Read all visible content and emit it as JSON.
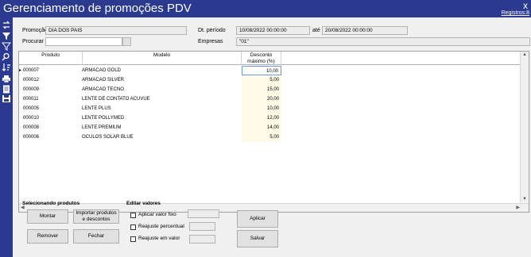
{
  "window": {
    "title": "Gerenciamento de promoções PDV",
    "close_glyph": "x",
    "registros_link": "Registros:8"
  },
  "toolbar": {
    "icons": [
      "transfer-icon",
      "filter-icon",
      "filter-outline-icon",
      "search-icon",
      "sort-icon",
      "print-icon",
      "document-icon",
      "save-icon"
    ]
  },
  "form": {
    "promocao_label": "Promoção",
    "promocao_value": "DIA DOS PAIS",
    "procurar_label": "Procurar",
    "procurar_value": "",
    "periodo_label": "Dt. período",
    "periodo_de": "10/08/2022 00:00:00",
    "ate_label": "até",
    "periodo_ate": "20/08/2022 00:00:00",
    "empresas_label": "Empresas",
    "empresas_value": "\"01\""
  },
  "grid": {
    "headers": {
      "produto": "Produto",
      "modelo": "Modelo",
      "desconto": "Desconto máximo (%)"
    },
    "rows": [
      {
        "produto": "000007",
        "modelo": "ARMACAO GOLD",
        "desconto": "10,00",
        "selected": true
      },
      {
        "produto": "000012",
        "modelo": "ARMACAO SILVER",
        "desconto": "5,00"
      },
      {
        "produto": "000009",
        "modelo": "ARMACAO TECNO",
        "desconto": "15,00"
      },
      {
        "produto": "000011",
        "modelo": "LENTE DE CONTATO ACUVUE",
        "desconto": "20,00"
      },
      {
        "produto": "000005",
        "modelo": "LENTE PLUS",
        "desconto": "10,00"
      },
      {
        "produto": "000010",
        "modelo": "LENTE POLLYMED",
        "desconto": "12,00"
      },
      {
        "produto": "000008",
        "modelo": "LENTE PREMIUM",
        "desconto": "14,00"
      },
      {
        "produto": "000006",
        "modelo": "OCULOS SOLAR BLUE",
        "desconto": "5,00"
      }
    ],
    "row_pointer": "▸"
  },
  "selecionando": {
    "title": "Selecionando produtos",
    "montar": "Montar",
    "importar": "Importar produtos e descontos",
    "remover": "Remover",
    "fechar": "Fechar"
  },
  "editar": {
    "title": "Editar valores",
    "aplicar_valor_fixo": "Aplicar valor fixo",
    "reajuste_percentual": "Reajuste percentual",
    "reajuste_em_valor": "Reajuste em valor",
    "aplicar": "Aplicar",
    "salvar": "Salvar"
  }
}
